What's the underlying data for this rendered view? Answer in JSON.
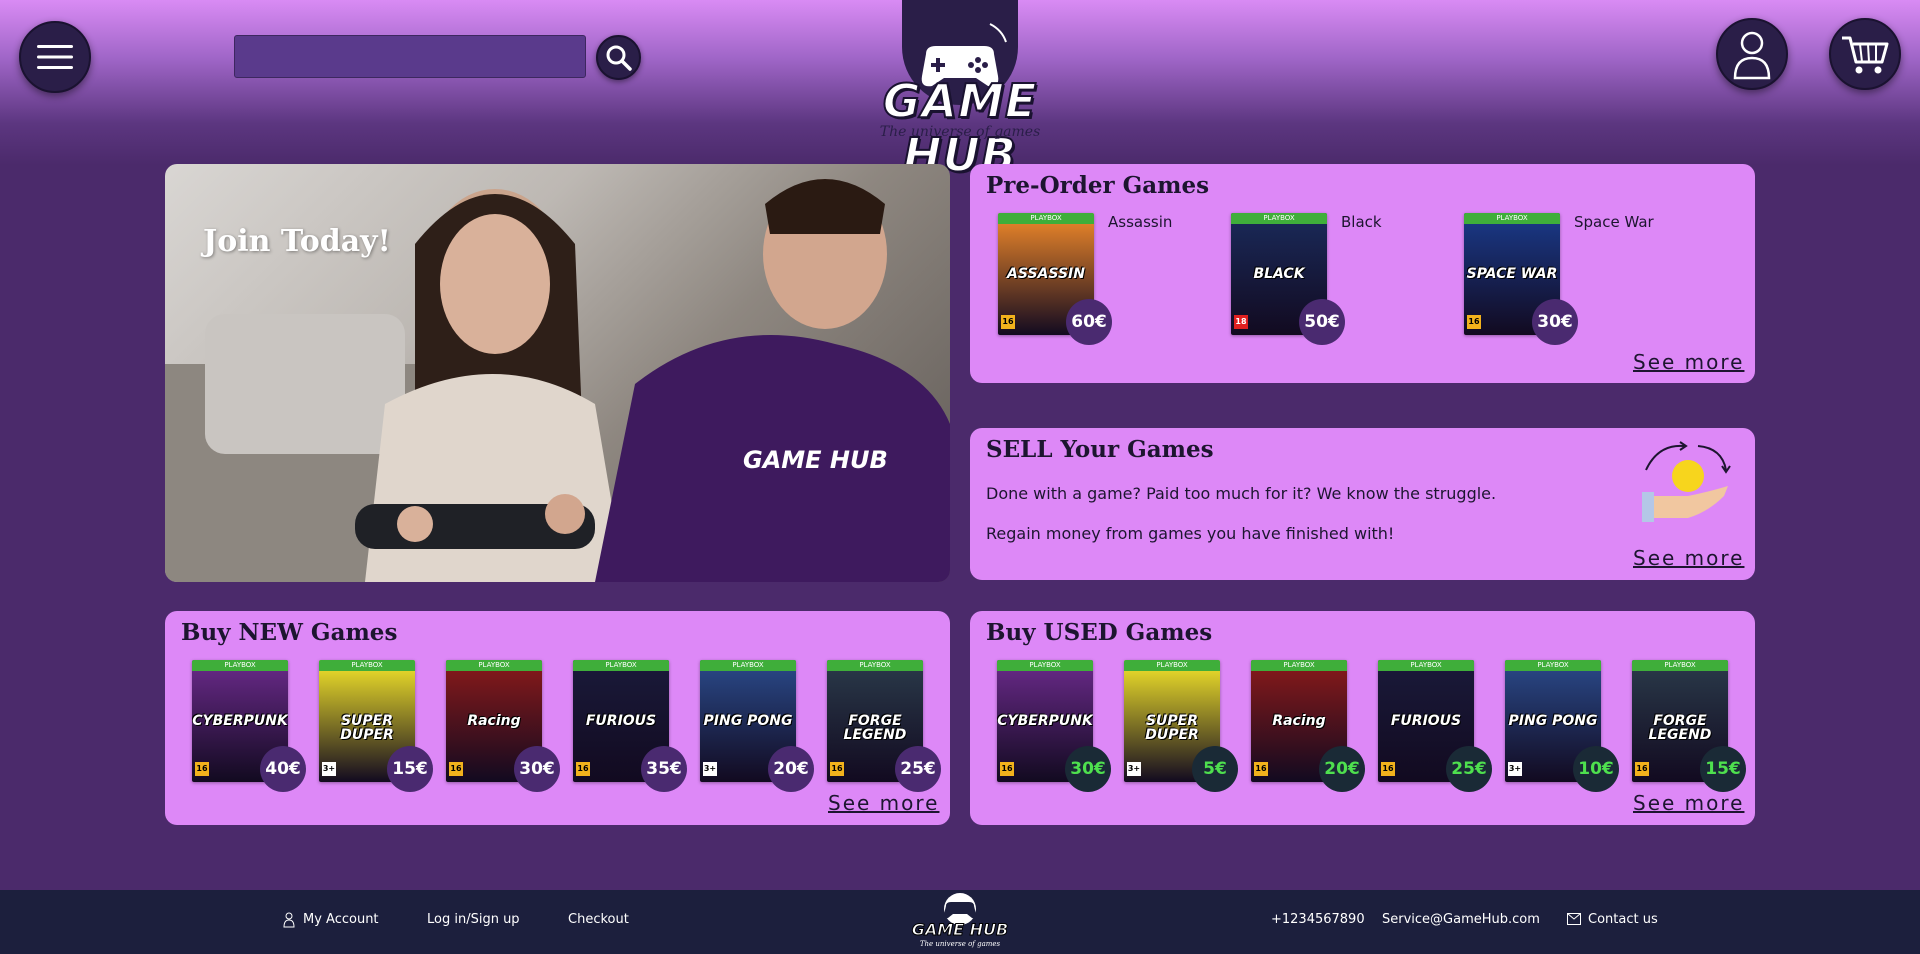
{
  "header": {
    "search": {
      "placeholder": "",
      "value": ""
    },
    "logo": {
      "title": "GAME HUB",
      "tagline": "The universe of games"
    }
  },
  "hero": {
    "headline": "Join Today!",
    "shirt_logo": "GAME HUB"
  },
  "preorder": {
    "title": "Pre-Order Games",
    "see_more": "See more",
    "games": [
      {
        "name": "Assassin",
        "cover_title": "ASSASSIN",
        "price": "60€",
        "age": "16",
        "color": "#f28a2a"
      },
      {
        "name": "Black",
        "cover_title": "BLACK",
        "price": "50€",
        "age": "18",
        "color": "#1a2a5a"
      },
      {
        "name": "Space War",
        "cover_title": "SPACE WAR",
        "price": "30€",
        "age": "16",
        "color": "#1a3a8a"
      }
    ]
  },
  "sell": {
    "title": "SELL Your Games",
    "line1": "Done with a game? Paid too much for it? We know the struggle.",
    "line2": "Regain money from games you have finished with!",
    "see_more": "See more"
  },
  "new_games": {
    "title": "Buy NEW Games",
    "see_more": "See more",
    "games": [
      {
        "cover_title": "CYBERPUNK",
        "price": "40€",
        "age": "16",
        "color": "#6a2a8a"
      },
      {
        "cover_title": "SUPER DUPER",
        "price": "15€",
        "age": "3+",
        "color": "#f5e62a"
      },
      {
        "cover_title": "Racing",
        "price": "30€",
        "age": "16",
        "color": "#8a1a1a"
      },
      {
        "cover_title": "FURIOUS",
        "price": "35€",
        "age": "16",
        "color": "#1a1a3a"
      },
      {
        "cover_title": "PING PONG",
        "price": "20€",
        "age": "3+",
        "color": "#2a4a8a"
      },
      {
        "cover_title": "FORGE LEGEND",
        "price": "25€",
        "age": "16",
        "color": "#2a3a4a"
      }
    ]
  },
  "used_games": {
    "title": "Buy USED Games",
    "see_more": "See more",
    "games": [
      {
        "cover_title": "CYBERPUNK",
        "price": "30€",
        "age": "16",
        "color": "#6a2a8a"
      },
      {
        "cover_title": "SUPER DUPER",
        "price": "5€",
        "age": "3+",
        "color": "#f5e62a"
      },
      {
        "cover_title": "Racing",
        "price": "20€",
        "age": "16",
        "color": "#8a1a1a"
      },
      {
        "cover_title": "FURIOUS",
        "price": "25€",
        "age": "16",
        "color": "#1a1a3a"
      },
      {
        "cover_title": "PING PONG",
        "price": "10€",
        "age": "3+",
        "color": "#2a4a8a"
      },
      {
        "cover_title": "FORGE LEGEND",
        "price": "15€",
        "age": "16",
        "color": "#2a3a4a"
      }
    ]
  },
  "cover_brand": "PLAYBOX",
  "footer": {
    "my_account": "My Account",
    "login": "Log in/Sign up",
    "checkout": "Checkout",
    "logo": "GAME HUB",
    "logo_tagline": "The universe of games",
    "phone": "+1234567890",
    "email": "Service@GameHub.com",
    "contact": "Contact us"
  }
}
